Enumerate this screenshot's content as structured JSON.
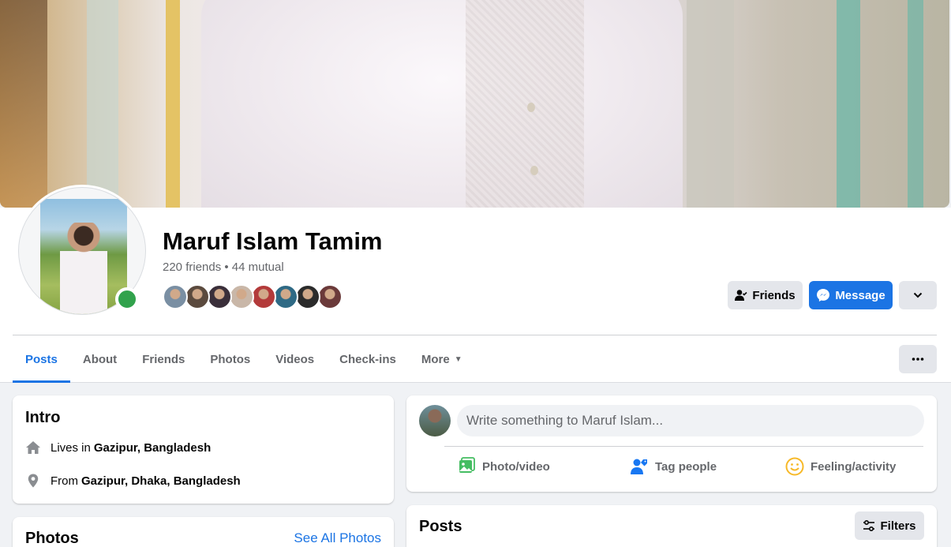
{
  "profile": {
    "name": "Maruf Islam Tamim",
    "friends_summary": "220 friends • 44 mutual",
    "online": true
  },
  "mutual_friend_faces": [
    "#7a8fa3",
    "#5b4a3e",
    "#3a2f3a",
    "#c9b7a8",
    "#b33a3a",
    "#2f6a85",
    "#2b2b2b",
    "#6b3a3a"
  ],
  "actions": {
    "friends_label": "Friends",
    "message_label": "Message"
  },
  "tabs": [
    {
      "label": "Posts",
      "active": true
    },
    {
      "label": "About",
      "active": false
    },
    {
      "label": "Friends",
      "active": false
    },
    {
      "label": "Photos",
      "active": false
    },
    {
      "label": "Videos",
      "active": false
    },
    {
      "label": "Check-ins",
      "active": false
    },
    {
      "label": "More",
      "active": false
    }
  ],
  "intro": {
    "title": "Intro",
    "lives_prefix": "Lives in",
    "lives_place": "Gazipur, Bangladesh",
    "from_prefix": "From",
    "from_place": "Gazipur, Dhaka, Bangladesh"
  },
  "photos": {
    "title": "Photos",
    "see_all": "See All Photos"
  },
  "composer": {
    "placeholder": "Write something to Maruf Islam...",
    "photo_video": "Photo/video",
    "tag_people": "Tag people",
    "feeling": "Feeling/activity"
  },
  "posts": {
    "title": "Posts",
    "filters": "Filters"
  },
  "colors": {
    "accent": "#1b74e4",
    "online": "#31a24c",
    "photo_green": "#45bd62",
    "feeling_yellow": "#f7b928"
  }
}
